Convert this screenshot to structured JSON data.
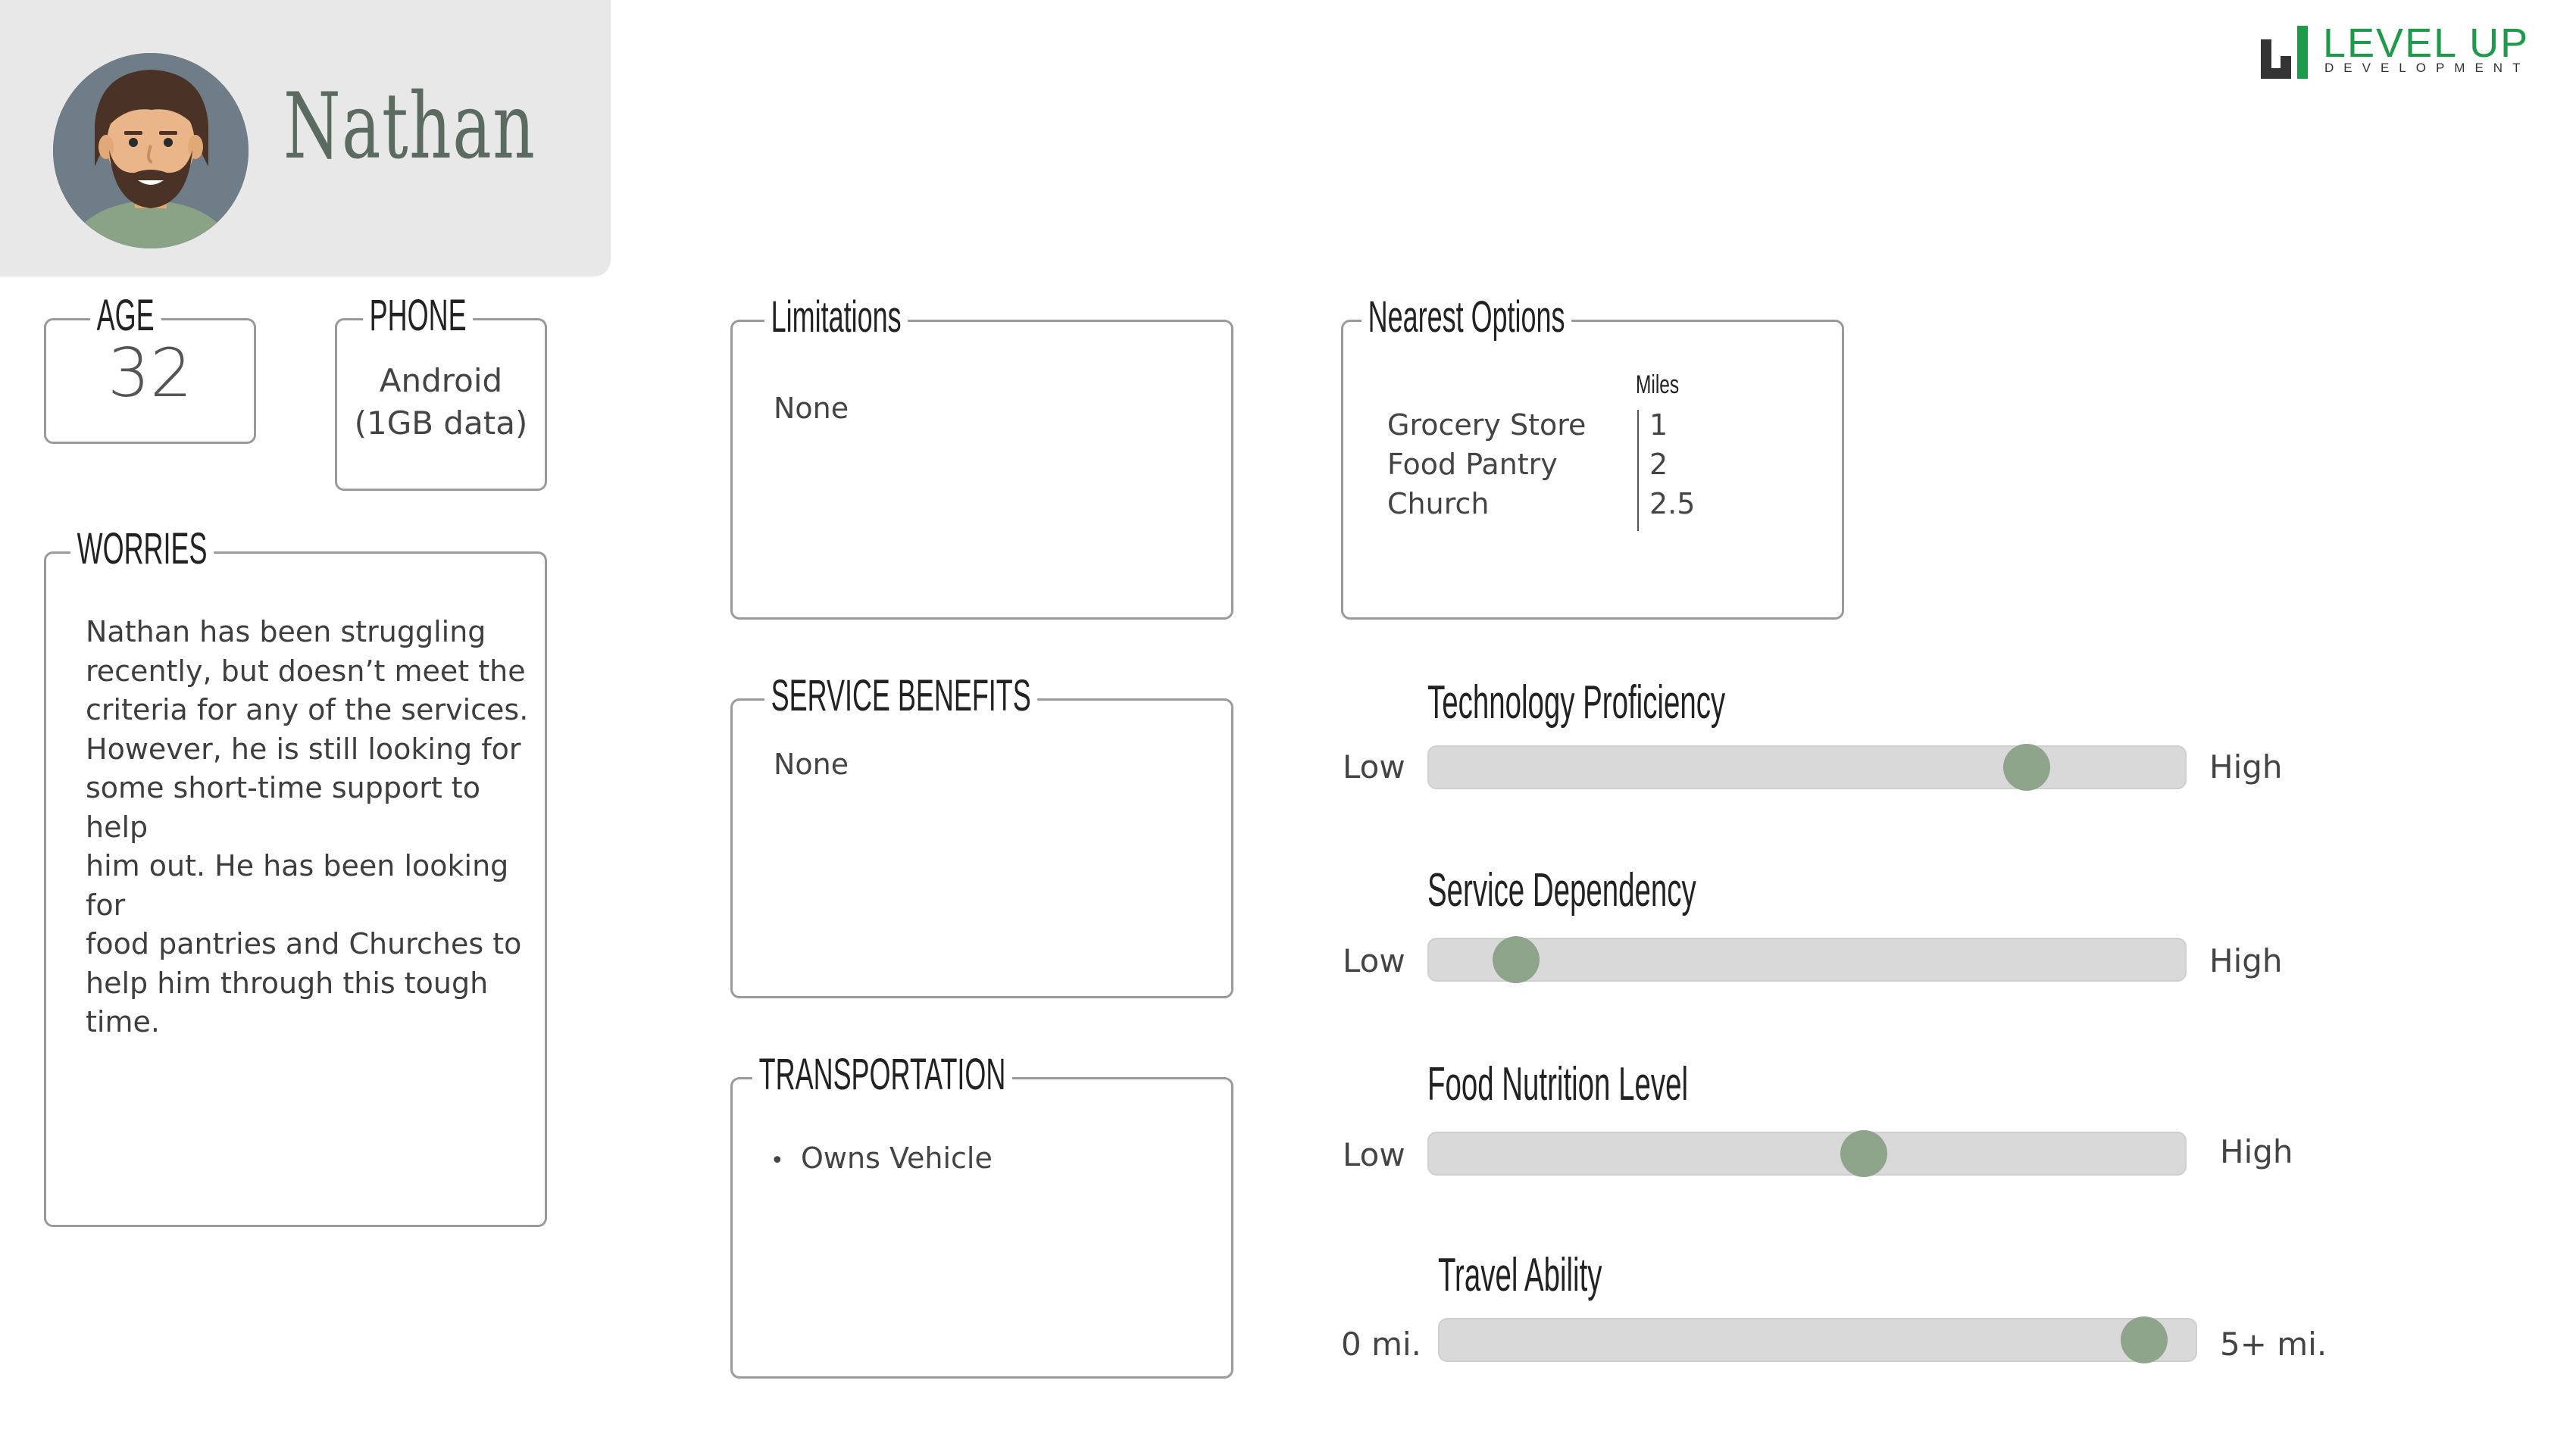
{
  "persona": {
    "name": "Nathan"
  },
  "logo": {
    "title": "LEVEL UP",
    "subtitle": "DEVELOPMENT",
    "accent": "#1f9a4a"
  },
  "age": {
    "label": "AGE",
    "value": "32"
  },
  "phone": {
    "label": "PHONE",
    "line1": "Android",
    "line2": "(1GB data)"
  },
  "worries": {
    "label": "WORRIES",
    "lines": [
      "Nathan has been struggling",
      "recently, but doesn’t meet the",
      "criteria for any of the services.",
      "However, he is still looking for",
      "some short-time support to help",
      "him out. He has been looking for",
      "food pantries and Churches to",
      "help him through this tough",
      "time."
    ]
  },
  "limitations": {
    "label": "Limitations",
    "text": "None"
  },
  "service_benefits": {
    "label": "SERVICE BENEFITS",
    "text": "None"
  },
  "transportation": {
    "label": "TRANSPORTATION",
    "items": [
      "Owns Vehicle"
    ]
  },
  "nearest_options": {
    "label": "Nearest Options",
    "miles_header": "Miles",
    "rows": [
      {
        "name": "Grocery Store",
        "miles": "1"
      },
      {
        "name": "Food Pantry",
        "miles": "2"
      },
      {
        "name": "Church",
        "miles": "2.5"
      }
    ]
  },
  "sliders": [
    {
      "title": "Technology Proficiency",
      "low": "Low",
      "high": "High",
      "value": 0.81
    },
    {
      "title": "Service Dependency",
      "low": "Low",
      "high": "High",
      "value": 0.09
    },
    {
      "title": "Food Nutrition Level",
      "low": "Low",
      "high": "High",
      "value": 0.58
    },
    {
      "title": "Travel Ability",
      "low": "0 mi.",
      "high": "5+ mi.",
      "value": 0.96
    }
  ],
  "colors": {
    "knob": "#8ea58c",
    "track": "#d9d9d9",
    "header_bg": "#e8e8e8",
    "name": "#5b6b61"
  }
}
